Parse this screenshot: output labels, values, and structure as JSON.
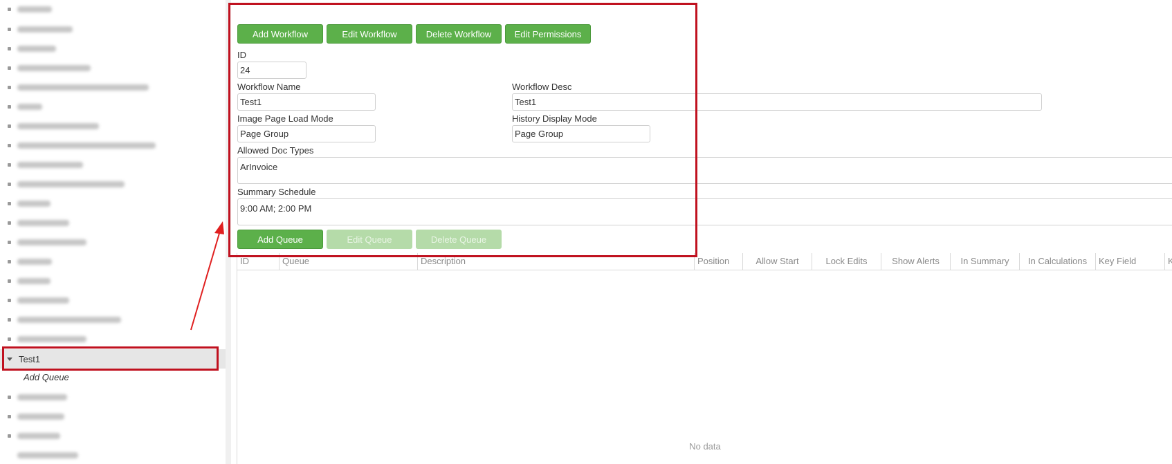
{
  "sidebar": {
    "selected_item": "Test1",
    "child_item": "Add Queue"
  },
  "toolbar": {
    "add_workflow": "Add Workflow",
    "edit_workflow": "Edit Workflow",
    "delete_workflow": "Delete Workflow",
    "edit_permissions": "Edit Permissions"
  },
  "form": {
    "id_label": "ID",
    "id_value": "24",
    "workflow_name_label": "Workflow Name",
    "workflow_name_value": "Test1",
    "workflow_desc_label": "Workflow Desc",
    "workflow_desc_value": "Test1",
    "image_page_load_mode_label": "Image Page Load Mode",
    "image_page_load_mode_value": "Page Group",
    "history_display_mode_label": "History Display Mode",
    "history_display_mode_value": "Page Group",
    "allowed_doc_types_label": "Allowed Doc Types",
    "allowed_doc_types_value": "ArInvoice",
    "summary_schedule_label": "Summary Schedule",
    "summary_schedule_value": "9:00 AM; 2:00 PM"
  },
  "queue_toolbar": {
    "add_queue": "Add Queue",
    "edit_queue": "Edit Queue",
    "delete_queue": "Delete Queue"
  },
  "grid": {
    "columns": [
      "ID",
      "Queue",
      "Description",
      "Position",
      "Allow Start",
      "Lock Edits",
      "Show Alerts",
      "In Summary",
      "In Calculations",
      "Key Field",
      "K"
    ],
    "empty_text": "No data"
  },
  "colors": {
    "button_green": "#5cb04a",
    "button_disabled": "#b5dba9",
    "annotation_red": "#c0111f"
  }
}
